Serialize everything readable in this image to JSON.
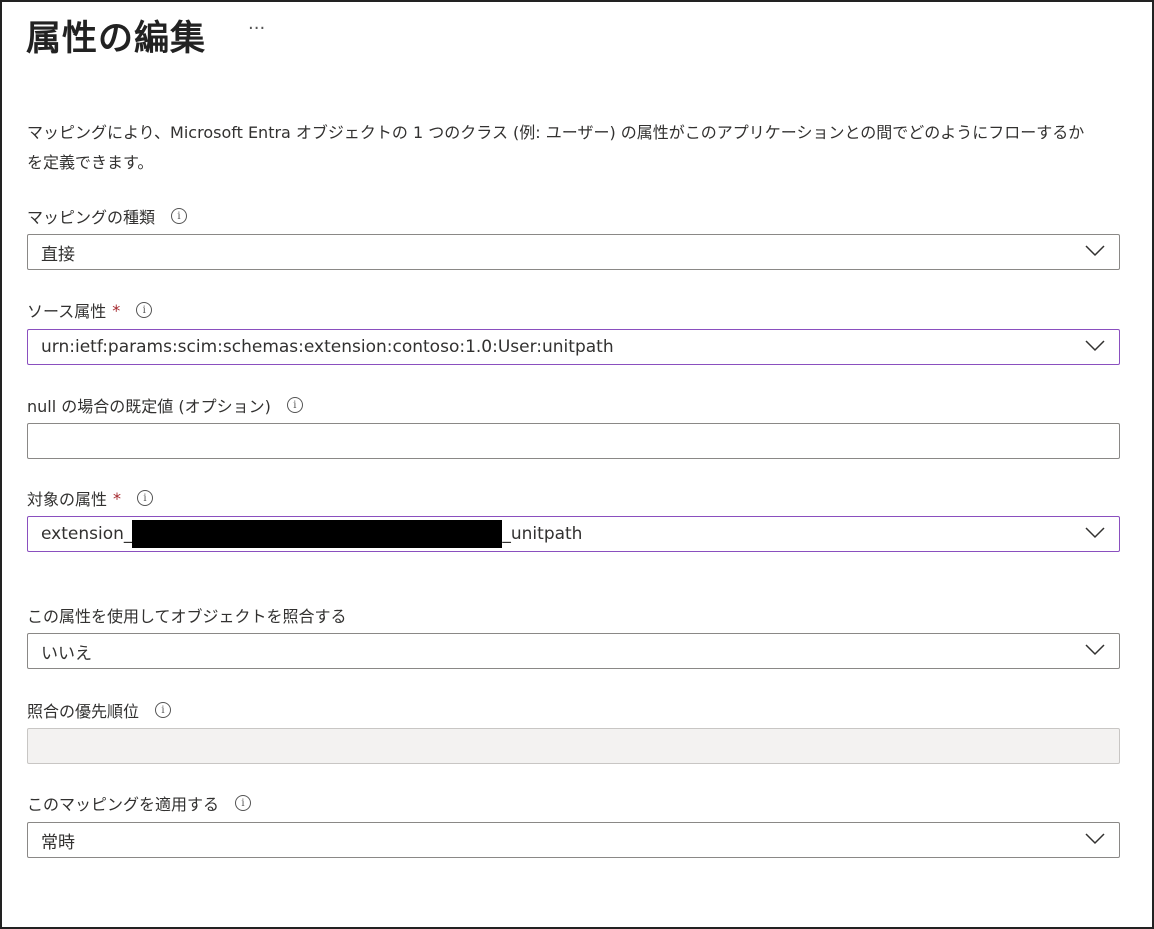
{
  "header": {
    "title": "属性の編集",
    "more_label": "···"
  },
  "description": {
    "line1": "マッピングにより、Microsoft Entra オブジェクトの 1 つのクラス (例: ユーザー) の属性がこのアプリケーションとの間でどのようにフローするか",
    "line2": "を定義できます。"
  },
  "fields": {
    "mapping_type": {
      "label": "マッピングの種類",
      "value": "直接"
    },
    "source_attribute": {
      "label": "ソース属性",
      "required": "*",
      "value": "urn:ietf:params:scim:schemas:extension:contoso:1.0:User:unitpath"
    },
    "default_value": {
      "label": "null の場合の既定値 (オプション)",
      "value": ""
    },
    "target_attribute": {
      "label": "対象の属性",
      "required": "*",
      "value_prefix": "extension_",
      "value_suffix": "_unitpath"
    },
    "match_objects": {
      "label": "この属性を使用してオブジェクトを照合する",
      "value": "いいえ"
    },
    "match_priority": {
      "label": "照合の優先順位",
      "value": ""
    },
    "apply_mapping": {
      "label": "このマッピングを適用する",
      "value": "常時"
    }
  },
  "colors": {
    "focus_border": "#8a4fbf",
    "required": "#a4262c"
  }
}
